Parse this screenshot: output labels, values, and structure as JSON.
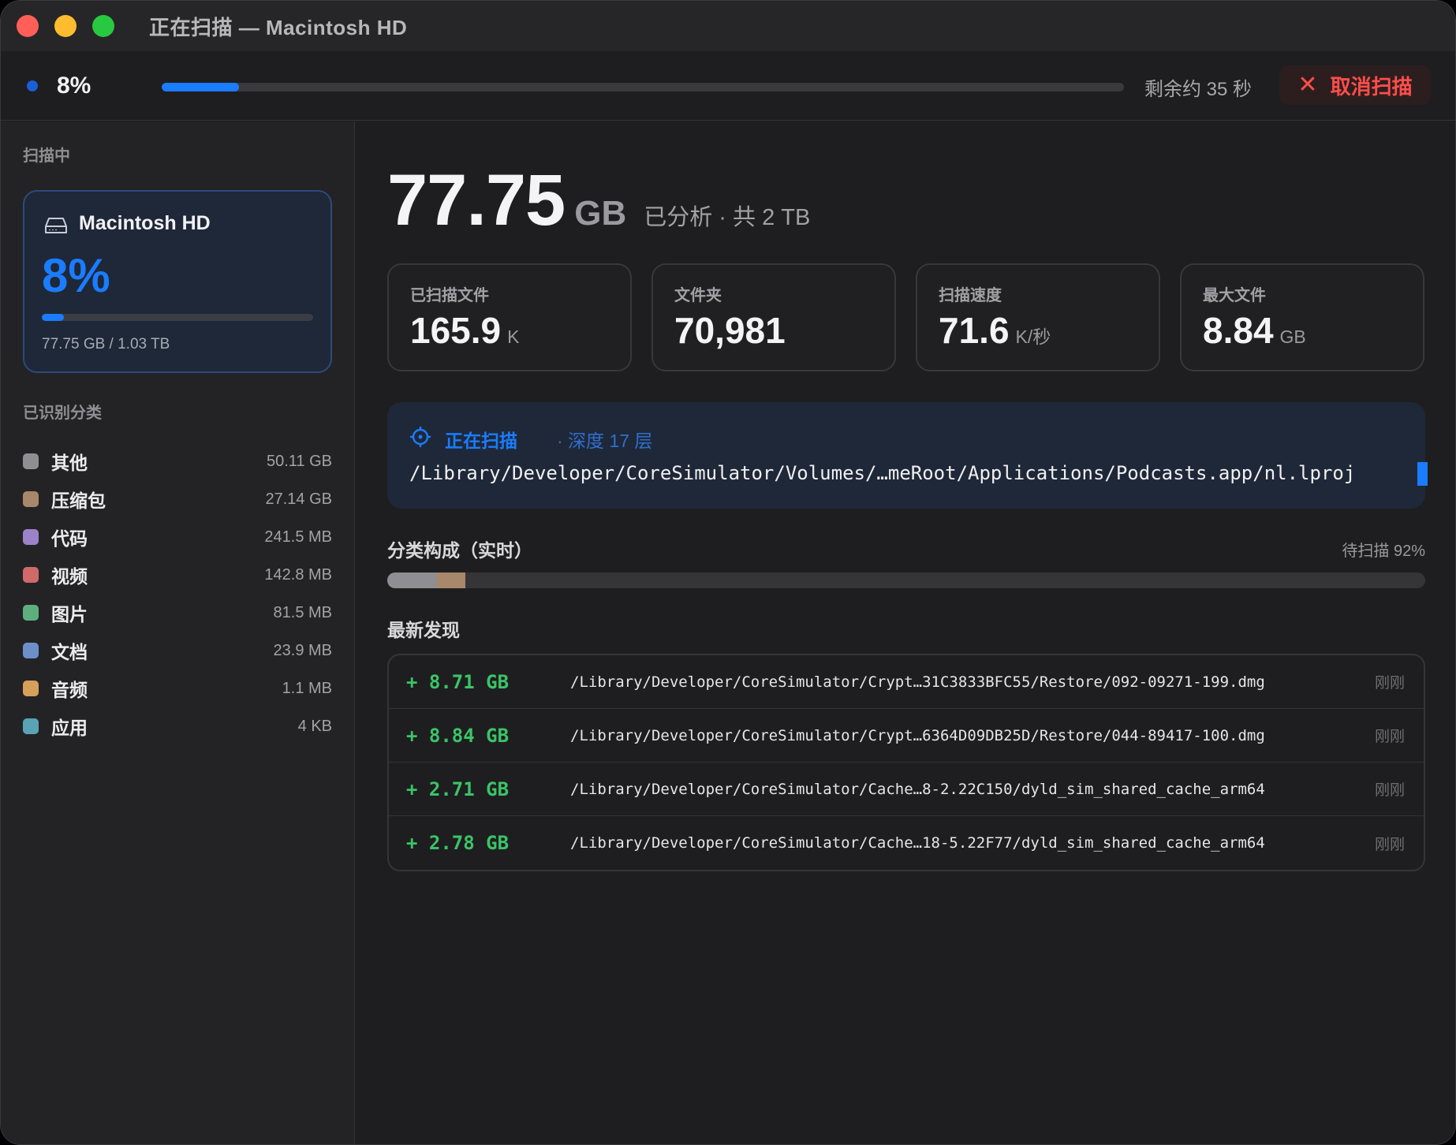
{
  "window": {
    "title": "正在扫描 — Macintosh HD"
  },
  "progress": {
    "percent": "8%",
    "fraction": 0.08,
    "remaining": "剩余约 35 秒",
    "cancel_label": "取消扫描"
  },
  "sidebar": {
    "scanning_header": "扫描中",
    "disk": {
      "name": "Macintosh HD",
      "percent": "8%",
      "fraction": 0.08,
      "size": "77.75 GB / 1.03 TB"
    },
    "categories_header": "已识别分类",
    "categories": [
      {
        "label": "其他",
        "size": "50.11 GB",
        "color": "#8e8e93"
      },
      {
        "label": "压缩包",
        "size": "27.14 GB",
        "color": "#a8876a"
      },
      {
        "label": "代码",
        "size": "241.5 MB",
        "color": "#9b82c9"
      },
      {
        "label": "视频",
        "size": "142.8 MB",
        "color": "#d06a6a"
      },
      {
        "label": "图片",
        "size": "81.5 MB",
        "color": "#5fae7e"
      },
      {
        "label": "文档",
        "size": "23.9 MB",
        "color": "#6c8fc9"
      },
      {
        "label": "音频",
        "size": "1.1 MB",
        "color": "#d6a05a"
      },
      {
        "label": "应用",
        "size": "4 KB",
        "color": "#5aa3b5"
      }
    ]
  },
  "main": {
    "analyzed_value": "77.75",
    "analyzed_unit": "GB",
    "analyzed_sub": "已分析 · 共 2 TB",
    "stats": [
      {
        "label": "已扫描文件",
        "value": "165.9",
        "unit": "K"
      },
      {
        "label": "文件夹",
        "value": "70,981",
        "unit": ""
      },
      {
        "label": "扫描速度",
        "value": "71.6",
        "unit": "K/秒"
      },
      {
        "label": "最大文件",
        "value": "8.84",
        "unit": "GB"
      }
    ],
    "current": {
      "title": "正在扫描",
      "depth": "· 深度 17 层",
      "path": "/Library/Developer/CoreSimulator/Volumes/…meRoot/Applications/Podcasts.app/nl.lproj"
    },
    "composition": {
      "title": "分类构成（实时）",
      "pending": "待扫描 92%",
      "segments": [
        {
          "category": "其他",
          "share": 0.048,
          "color": "#8e8e93"
        },
        {
          "category": "压缩包",
          "share": 0.027,
          "color": "#a8876a"
        }
      ]
    },
    "finds": {
      "title": "最新发现",
      "rows": [
        {
          "size": "+ 8.71 GB",
          "path": "/Library/Developer/CoreSimulator/Crypt…31C3833BFC55/Restore/092-09271-199.dmg",
          "time": "刚刚"
        },
        {
          "size": "+ 8.84 GB",
          "path": "/Library/Developer/CoreSimulator/Crypt…6364D09DB25D/Restore/044-89417-100.dmg",
          "time": "刚刚"
        },
        {
          "size": "+ 2.71 GB",
          "path": "/Library/Developer/CoreSimulator/Cache…8-2.22C150/dyld_sim_shared_cache_arm64",
          "time": "刚刚"
        },
        {
          "size": "+ 2.78 GB",
          "path": "/Library/Developer/CoreSimulator/Cache…18-5.22F77/dyld_sim_shared_cache_arm64",
          "time": "刚刚"
        }
      ]
    }
  }
}
